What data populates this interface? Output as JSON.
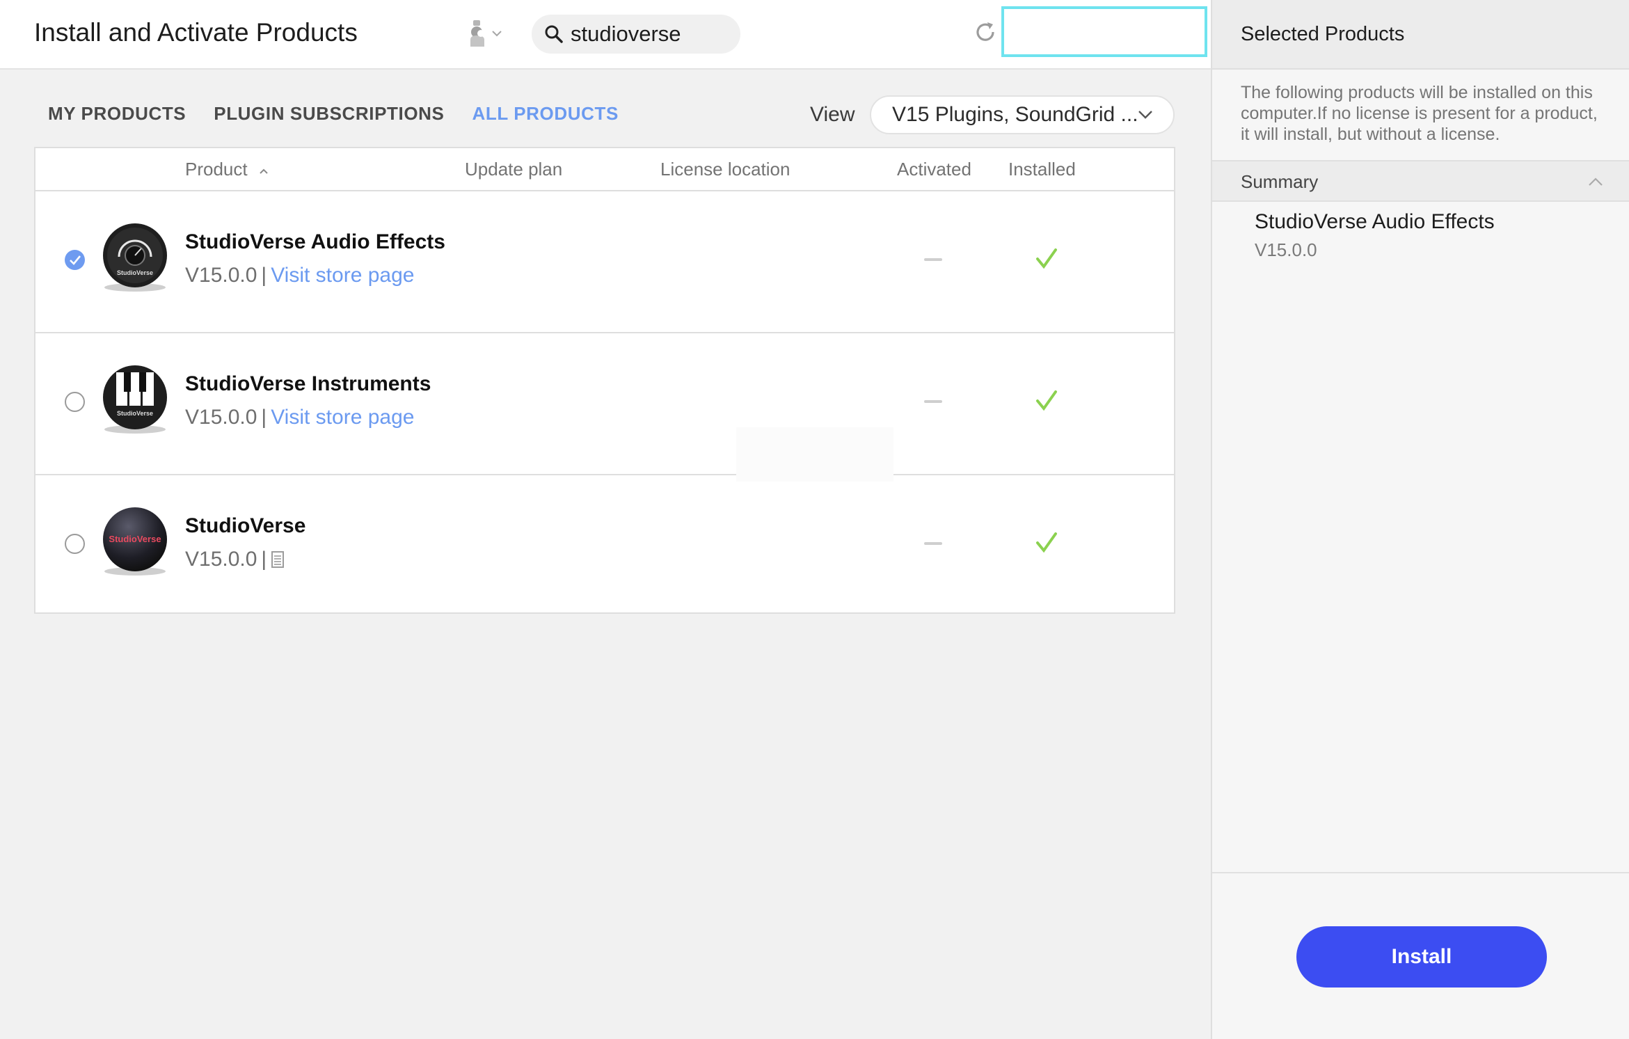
{
  "header": {
    "title": "Install and Activate Products",
    "search_value": "studioverse",
    "user_icon": "user-icon",
    "refresh_icon": "refresh-icon"
  },
  "tabs": [
    {
      "label": "MY PRODUCTS",
      "active": false
    },
    {
      "label": "PLUGIN SUBSCRIPTIONS",
      "active": false
    },
    {
      "label": "ALL PRODUCTS",
      "active": true
    }
  ],
  "view": {
    "label": "View",
    "selected": "V15 Plugins, SoundGrid ..."
  },
  "table": {
    "columns": [
      "Product",
      "Update plan",
      "License location",
      "Activated",
      "Installed"
    ],
    "rows": [
      {
        "name": "StudioVerse Audio Effects",
        "version": "V15.0.0",
        "separator": "|",
        "link": "Visit store page",
        "selected": true,
        "activated": "—",
        "installed": "✓"
      },
      {
        "name": "StudioVerse Instruments",
        "version": "V15.0.0",
        "separator": "|",
        "link": "Visit store page",
        "selected": false,
        "activated": "—",
        "installed": "✓"
      },
      {
        "name": "StudioVerse",
        "version": "V15.0.0",
        "separator": "|",
        "link": "",
        "selected": false,
        "activated": "—",
        "installed": "✓"
      }
    ],
    "icon_labels": [
      "StudioVerse",
      "StudioVerse",
      "StudioVerse"
    ]
  },
  "side": {
    "title": "Selected Products",
    "description": "The following products will be installed on this computer.If no license is present for a product, it will install, but without a license.",
    "summary_label": "Summary",
    "summary_items": [
      {
        "name": "StudioVerse Audio Effects",
        "version": "V15.0.0"
      }
    ],
    "install_label": "Install"
  },
  "colors": {
    "accent": "#6b9af0",
    "install_button": "#3c4df2",
    "check_green": "#8bd14f",
    "highlight": "#6fe3ef"
  }
}
